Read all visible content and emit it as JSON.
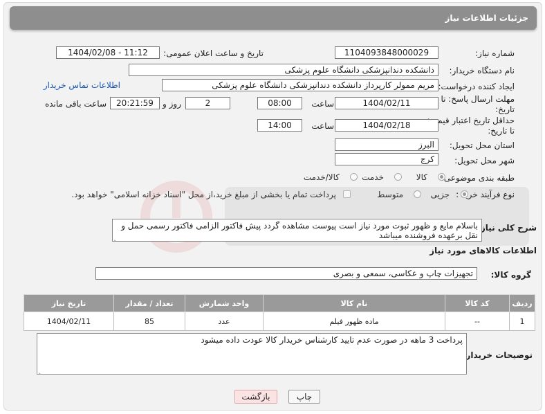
{
  "header": {
    "title": "جزئیات اطلاعات نیاز"
  },
  "labels": {
    "need_number": "شماره نیاز:",
    "announce_datetime": "تاریخ و ساعت اعلان عمومی:",
    "buyer_org": "نام دستگاه خریدار:",
    "requester": "ایجاد کننده درخواست:",
    "reply_deadline": "مهلت ارسال پاسخ: تا تاریخ:",
    "price_validity": "حداقل تاریخ اعتبار قیمت: تا تاریخ:",
    "time": "ساعت",
    "day_and": "روز و",
    "remaining": "ساعت باقی مانده",
    "province": "استان محل تحویل:",
    "city": "شهر محل تحویل:",
    "category": "طبقه بندی موضوعی:",
    "purchase_type": "نوع فرآیند خرید :",
    "description": "شرح کلی نیاز:",
    "goods_info": "اطلاعات کالاهای مورد نیاز",
    "goods_group": "گروه کالا:",
    "buyer_notes": "توضیحات خریدار:"
  },
  "form": {
    "need_number": "1104093848000029",
    "announce_datetime": "1404/02/08 - 11:12",
    "buyer_org": "دانشکده دندانپزشکی دانشگاه علوم پزشکی",
    "requester": "مریم ممولر کارپرداز دانشکده دندانپزشکی دانشگاه علوم پزشکی",
    "contact_link": "اطلاعات تماس خریدار",
    "reply_date": "1404/02/11",
    "reply_time": "08:00",
    "reply_days": "2",
    "reply_remaining": "20:21:59",
    "validity_date": "1404/02/18",
    "validity_time": "14:00",
    "province": "البرز",
    "city": "کرج",
    "category_options": [
      "کالا",
      "خدمت",
      "کالا/خدمت"
    ],
    "category_selected": "کالا",
    "purchase_options": [
      "جزیی",
      "متوسط"
    ],
    "purchase_selected": "جزیی",
    "treasury_note": "پرداخت تمام یا بخشی از مبلغ خرید،از محل \"اسناد خزانه اسلامی\" خواهد بود.",
    "description": "باسلام مایع و ظهور ثبوت مورد نیاز است پیوست مشاهده گردد پیش فاکتور الزامی فاکتور رسمی  حمل و نقل برعهده فروشنده میباشد",
    "goods_group": "تجهیزات چاپ و عکاسی، سمعی و بصری",
    "buyer_notes": "پرداخت 3 ماهه در صورت عدم تایید کارشناس خریدار کالا عودت داده میشود"
  },
  "table": {
    "headers": [
      "ردیف",
      "کد کالا",
      "نام کالا",
      "واحد شمارش",
      "تعداد / مقدار",
      "تاریخ نیاز"
    ],
    "rows": [
      [
        "1",
        "--",
        "ماده ظهور فیلم",
        "عدد",
        "85",
        "1404/02/11"
      ]
    ]
  },
  "buttons": {
    "print": "چاپ",
    "back": "بازگشت"
  },
  "colors": {
    "header_bg": "#8e8e8e",
    "table_header_bg": "#9a9a9a",
    "link": "#1a56b0",
    "back_button_bg": "#fbe3e3"
  }
}
